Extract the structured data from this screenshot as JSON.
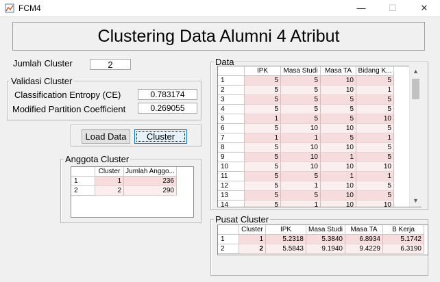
{
  "window": {
    "title": "FCM4",
    "minimize": "—",
    "maximize": "☐",
    "close": "✕"
  },
  "heading": "Clustering Data Alumni 4 Atribut",
  "jumlah_cluster": {
    "label": "Jumlah Cluster",
    "value": "2"
  },
  "validasi": {
    "title": "Validasi Cluster",
    "ce_label": "Classification Entropy (CE)",
    "ce_value": "0.783174",
    "mpc_label": "Modified Partition Coefficient",
    "mpc_value": "0.269055"
  },
  "buttons": {
    "load": "Load Data",
    "cluster": "Cluster"
  },
  "anggota": {
    "title": "Anggota Cluster",
    "columns": [
      "Cluster",
      "Jumlah Anggo..."
    ],
    "rows": [
      {
        "n": "1",
        "cells": [
          "1",
          "236"
        ]
      },
      {
        "n": "2",
        "cells": [
          "2",
          "290"
        ]
      }
    ]
  },
  "data": {
    "title": "Data",
    "columns": [
      "IPK",
      "Masa Studi",
      "Masa TA",
      "Bidang K..."
    ],
    "rows": [
      {
        "n": "1",
        "cells": [
          "5",
          "5",
          "10",
          "5"
        ]
      },
      {
        "n": "2",
        "cells": [
          "5",
          "5",
          "10",
          "1"
        ]
      },
      {
        "n": "3",
        "cells": [
          "5",
          "5",
          "5",
          "5"
        ]
      },
      {
        "n": "4",
        "cells": [
          "5",
          "5",
          "5",
          "5"
        ]
      },
      {
        "n": "5",
        "cells": [
          "1",
          "5",
          "5",
          "10"
        ]
      },
      {
        "n": "6",
        "cells": [
          "5",
          "10",
          "10",
          "5"
        ]
      },
      {
        "n": "7",
        "cells": [
          "1",
          "1",
          "5",
          "1"
        ]
      },
      {
        "n": "8",
        "cells": [
          "5",
          "10",
          "10",
          "5"
        ]
      },
      {
        "n": "9",
        "cells": [
          "5",
          "10",
          "1",
          "5"
        ]
      },
      {
        "n": "10",
        "cells": [
          "5",
          "10",
          "10",
          "10"
        ]
      },
      {
        "n": "11",
        "cells": [
          "5",
          "5",
          "1",
          "1"
        ]
      },
      {
        "n": "12",
        "cells": [
          "5",
          "1",
          "10",
          "5"
        ]
      },
      {
        "n": "13",
        "cells": [
          "5",
          "5",
          "10",
          "5"
        ]
      },
      {
        "n": "14",
        "cells": [
          "5",
          "1",
          "10",
          "10"
        ]
      }
    ]
  },
  "pusat": {
    "title": "Pusat Cluster",
    "columns": [
      "Cluster",
      "IPK",
      "Masa Studi",
      "Masa TA",
      "B Kerja"
    ],
    "rows": [
      {
        "n": "1",
        "cells": [
          "1",
          "5.2318",
          "5.3840",
          "6.8934",
          "5.1742"
        ]
      },
      {
        "n": "2",
        "cells": [
          "2",
          "5.5843",
          "9.1940",
          "9.4229",
          "6.3190"
        ]
      }
    ]
  }
}
